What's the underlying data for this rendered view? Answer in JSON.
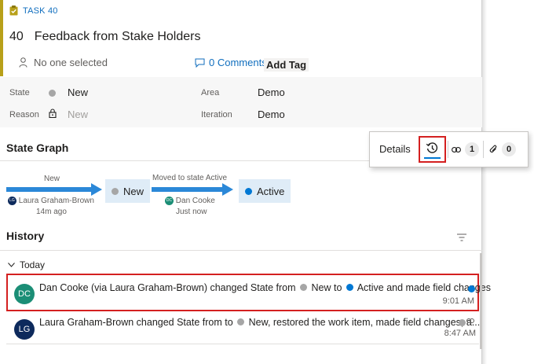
{
  "task": {
    "type_label": "TASK 40"
  },
  "title": {
    "id": "40",
    "text": "Feedback from Stake Holders"
  },
  "assignee": {
    "label": "No one selected"
  },
  "comments": {
    "label": "0 Comments"
  },
  "add_tag": {
    "label": "Add Tag"
  },
  "fields": {
    "state": {
      "label": "State",
      "value": "New"
    },
    "reason": {
      "label": "Reason",
      "value": "New"
    },
    "area": {
      "label": "Area",
      "value": "Demo"
    },
    "iteration": {
      "label": "Iteration",
      "value": "Demo"
    }
  },
  "state_graph": {
    "title": "State Graph",
    "transition1": {
      "label": "New",
      "user_initials": "LG",
      "user": "Laura Graham-Brown",
      "time": "14m ago"
    },
    "state1": {
      "label": "New"
    },
    "transition2": {
      "label": "Moved to state Active",
      "user_initials": "DC",
      "user": "Dan Cooke",
      "time": "Just now"
    },
    "state2": {
      "label": "Active"
    }
  },
  "tabs": {
    "details": "Details",
    "links_count": "1",
    "attachments_count": "0"
  },
  "history": {
    "title": "History",
    "group": "Today",
    "items": [
      {
        "initials": "DC",
        "pre": "Dan Cooke (via Laura Graham-Brown) changed State from",
        "from": "New to",
        "to": "Active and made field changes",
        "time": "9:01 AM"
      },
      {
        "initials": "LG",
        "pre": "Laura Graham-Brown changed State from to",
        "to": "New, restored the work item, made field changes, a...",
        "time": "8:47 AM"
      }
    ]
  },
  "colors": {
    "accent": "#b8a019",
    "link": "#106ebe",
    "state_new": "#a6a6a6",
    "state_active": "#0078d4",
    "highlight": "#d42020",
    "avatar_dc": "#1b8e76",
    "avatar_lg": "#0d2a5c"
  }
}
